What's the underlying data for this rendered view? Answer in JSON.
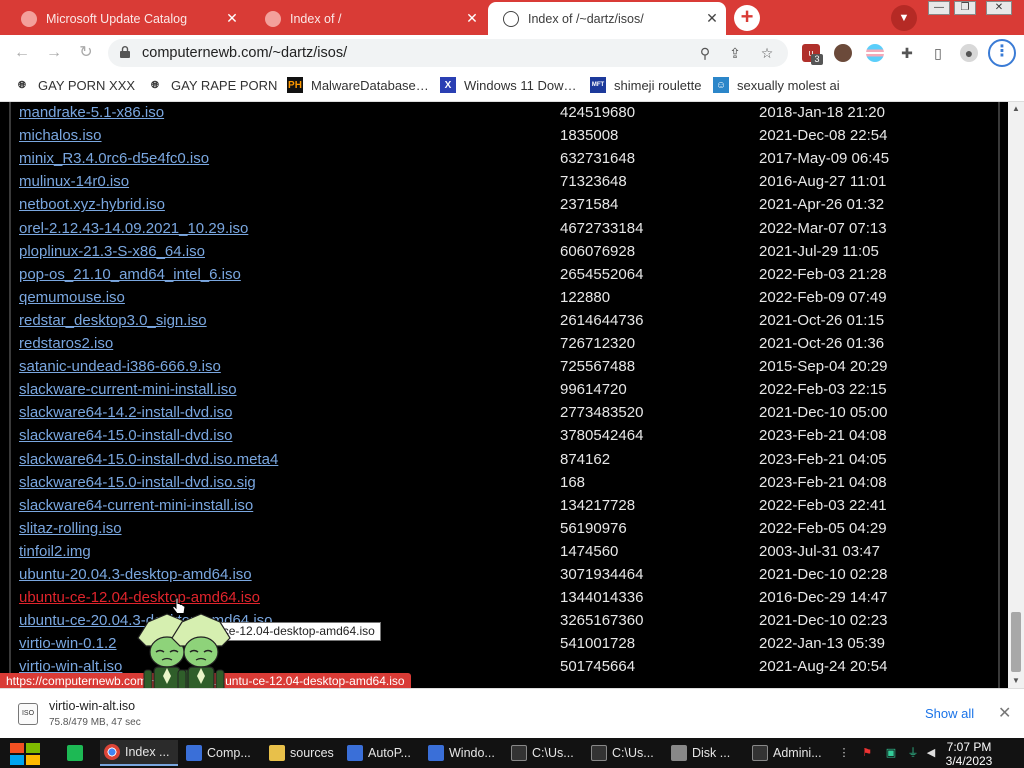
{
  "tabs": [
    {
      "label": "Microsoft Update Catalog",
      "active": false
    },
    {
      "label": "Index of /",
      "active": false
    },
    {
      "label": "Index of /~dartz/isos/",
      "active": true
    }
  ],
  "toolbar": {
    "url": "computernewb.com/~dartz/isos/",
    "extension_badge": "3"
  },
  "bookmarks": [
    {
      "label": "GAY PORN XXX",
      "icon": "globe-icon"
    },
    {
      "label": "GAY RAPE PORN",
      "icon": "globe-icon"
    },
    {
      "label": "MalwareDatabase…",
      "icon": "ph-logo-icon",
      "icon_text": "PH"
    },
    {
      "label": "Windows 11 Dow…",
      "icon": "x-logo-icon",
      "icon_text": "X"
    },
    {
      "label": "shimeji roulette",
      "icon": "app-icon",
      "icon_text": "MFT"
    },
    {
      "label": "sexually molest ai",
      "icon": "robot-icon"
    }
  ],
  "listing": [
    {
      "name": "mandrake-5.1-x86.iso",
      "size": "424519680",
      "date": "2018-Jan-18 21:20"
    },
    {
      "name": "michalos.iso",
      "size": "1835008",
      "date": "2021-Dec-08 22:54"
    },
    {
      "name": "minix_R3.4.0rc6-d5e4fc0.iso",
      "size": "632731648",
      "date": "2017-May-09 06:45"
    },
    {
      "name": "mulinux-14r0.iso",
      "size": "71323648",
      "date": "2016-Aug-27 11:01"
    },
    {
      "name": "netboot.xyz-hybrid.iso",
      "size": "2371584",
      "date": "2021-Apr-26 01:32"
    },
    {
      "name": "orel-2.12.43-14.09.2021_10.29.iso",
      "size": "4672733184",
      "date": "2022-Mar-07 07:13"
    },
    {
      "name": "ploplinux-21.3-S-x86_64.iso",
      "size": "606076928",
      "date": "2021-Jul-29 11:05"
    },
    {
      "name": "pop-os_21.10_amd64_intel_6.iso",
      "size": "2654552064",
      "date": "2022-Feb-03 21:28"
    },
    {
      "name": "qemumouse.iso",
      "size": "122880",
      "date": "2022-Feb-09 07:49"
    },
    {
      "name": "redstar_desktop3.0_sign.iso",
      "size": "2614644736",
      "date": "2021-Oct-26 01:15"
    },
    {
      "name": "redstaros2.iso",
      "size": "726712320",
      "date": "2021-Oct-26 01:36"
    },
    {
      "name": "satanic-undead-i386-666.9.iso",
      "size": "725567488",
      "date": "2015-Sep-04 20:29"
    },
    {
      "name": "slackware-current-mini-install.iso",
      "size": "99614720",
      "date": "2022-Feb-03 22:15"
    },
    {
      "name": "slackware64-14.2-install-dvd.iso",
      "size": "2773483520",
      "date": "2021-Dec-10 05:00"
    },
    {
      "name": "slackware64-15.0-install-dvd.iso",
      "size": "3780542464",
      "date": "2023-Feb-21 04:08"
    },
    {
      "name": "slackware64-15.0-install-dvd.iso.meta4",
      "size": "874162",
      "date": "2023-Feb-21 04:05"
    },
    {
      "name": "slackware64-15.0-install-dvd.iso.sig",
      "size": "168",
      "date": "2023-Feb-21 04:08"
    },
    {
      "name": "slackware64-current-mini-install.iso",
      "size": "134217728",
      "date": "2022-Feb-03 22:41"
    },
    {
      "name": "slitaz-rolling.iso",
      "size": "56190976",
      "date": "2022-Feb-05 04:29"
    },
    {
      "name": "tinfoil2.img",
      "size": "1474560",
      "date": "2003-Jul-31 03:47"
    },
    {
      "name": "ubuntu-20.04.3-desktop-amd64.iso",
      "size": "3071934464",
      "date": "2021-Dec-10 02:28"
    },
    {
      "name": "ubuntu-ce-12.04-desktop-amd64.iso",
      "size": "1344014336",
      "date": "2016-Dec-29 14:47",
      "hover": true
    },
    {
      "name": "ubuntu-ce-20.04.3-desktop-amd64.iso",
      "size": "3265167360",
      "date": "2021-Dec-10 02:23"
    },
    {
      "name": "virtio-win-0.1.2",
      "size": "541001728",
      "date": "2022-Jan-13 05:39"
    },
    {
      "name": "virtio-win-alt.iso",
      "size": "501745664",
      "date": "2021-Aug-24 20:54"
    }
  ],
  "tooltip": "ubuntu-ce-12.04-desktop-amd64.iso",
  "status_url": "https://computernewb.com/~dartz/isos/ubuntu-ce-12.04-desktop-amd64.iso",
  "download": {
    "filename": "virtio-win-alt.iso",
    "progress": "75.8/479 MB, 47 sec",
    "icon_text": "ISO",
    "show_all": "Show all"
  },
  "taskbar": {
    "tasks": [
      {
        "label": "",
        "icon": "spotify-icon"
      },
      {
        "label": "Index ...",
        "icon": "chrome-icon",
        "active": true
      },
      {
        "label": "Comp...",
        "icon": "app-icon"
      },
      {
        "label": "sources",
        "icon": "folder-icon"
      },
      {
        "label": "AutoP...",
        "icon": "app-icon"
      },
      {
        "label": "Windo...",
        "icon": "app-icon"
      },
      {
        "label": "C:\\Us...",
        "icon": "terminal-icon"
      },
      {
        "label": "C:\\Us...",
        "icon": "terminal-icon"
      },
      {
        "label": "Disk ...",
        "icon": "disk-icon"
      },
      {
        "label": "Admini...",
        "icon": "terminal-icon"
      }
    ],
    "clock_time": "7:07 PM",
    "clock_date": "3/4/2023"
  },
  "colors": {
    "tabstrip": "#d93b36",
    "link": "#7aa7e0",
    "link_hover": "#e0242c",
    "page_bg": "#000000"
  }
}
